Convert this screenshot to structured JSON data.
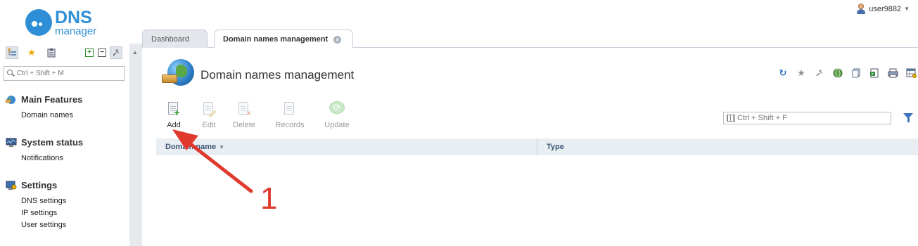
{
  "app": {
    "logo_primary": "DNS",
    "logo_secondary": "manager"
  },
  "user": {
    "name": "user9882"
  },
  "sidebar": {
    "search_placeholder": "Ctrl + Shift + M",
    "sections": [
      {
        "title": "Main Features",
        "icon": "globe-icon",
        "items": [
          "Domain names"
        ]
      },
      {
        "title": "System status",
        "icon": "monitor-icon",
        "items": [
          "Notifications"
        ]
      },
      {
        "title": "Settings",
        "icon": "settings-monitor-icon",
        "items": [
          "DNS settings",
          "IP settings",
          "User settings"
        ]
      }
    ]
  },
  "tabs": [
    {
      "label": "Dashboard",
      "active": false
    },
    {
      "label": "Domain names management",
      "active": true
    }
  ],
  "page": {
    "title": "Domain names management"
  },
  "toolbar": {
    "add": "Add",
    "edit": "Edit",
    "delete": "Delete",
    "records": "Records",
    "update": "Update"
  },
  "filter": {
    "placeholder": "Ctrl + Shift + F"
  },
  "table": {
    "columns": [
      "Domain name",
      "Type"
    ]
  },
  "annotation": {
    "number": "1",
    "color": "#e03a2e"
  },
  "colors": {
    "brand": "#2f8fd6",
    "header_text": "#3b5575"
  }
}
